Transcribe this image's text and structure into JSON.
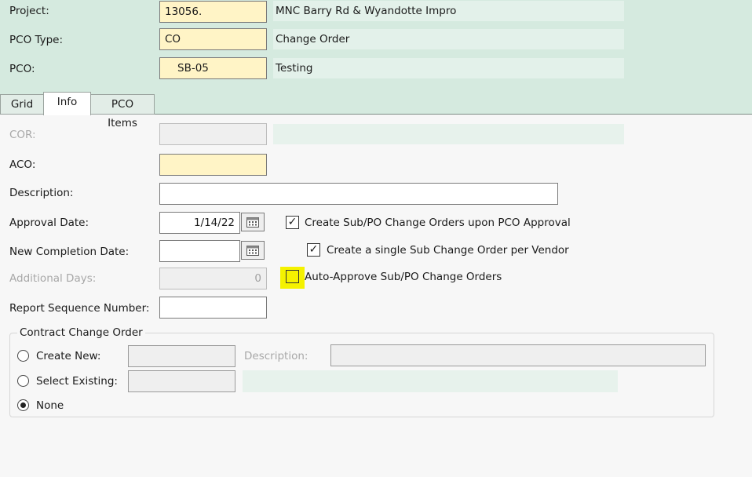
{
  "header": {
    "project": {
      "label": "Project:",
      "code": "13056.",
      "name": "MNC Barry Rd & Wyandotte Impro"
    },
    "pco_type": {
      "label": "PCO Type:",
      "code": "CO",
      "name": "Change Order"
    },
    "pco": {
      "label": "PCO:",
      "code": "SB-05",
      "name": "Testing"
    }
  },
  "tabs": [
    {
      "label": "Grid",
      "active": false
    },
    {
      "label": "Info",
      "active": true
    },
    {
      "label": "PCO Items",
      "active": false
    }
  ],
  "form": {
    "cor": {
      "label": "COR:",
      "value": ""
    },
    "aco": {
      "label": "ACO:",
      "value": ""
    },
    "description": {
      "label": "Description:",
      "value": ""
    },
    "approval_date": {
      "label": "Approval Date:",
      "value": "1/14/22"
    },
    "new_completion_date": {
      "label": "New Completion Date:",
      "value": ""
    },
    "additional_days": {
      "label": "Additional Days:",
      "value": "0"
    },
    "report_sequence": {
      "label": "Report Sequence Number:",
      "value": ""
    },
    "checkboxes": {
      "create_sub_po": {
        "label": "Create Sub/PO Change Orders upon PCO Approval",
        "checked": true
      },
      "single_per_vendor": {
        "label": "Create a single Sub Change Order per Vendor",
        "checked": true
      },
      "auto_approve": {
        "label": "Auto-Approve Sub/PO Change Orders",
        "checked": false,
        "highlight_color": "#f5f200"
      }
    }
  },
  "contract_change_order": {
    "legend": "Contract Change Order",
    "create_new": {
      "label": "Create New:",
      "selected": false,
      "value": ""
    },
    "description": {
      "label": "Description:",
      "value": ""
    },
    "select_existing": {
      "label": "Select Existing:",
      "selected": false,
      "value": ""
    },
    "none": {
      "label": "None",
      "selected": true
    }
  },
  "colors": {
    "header_bg": "#d5eadf",
    "required_field": "#fff4c6",
    "highlight": "#f5f200"
  },
  "icons": [
    "calendar-icon",
    "checkmark-icon",
    "radio-dot-icon"
  ]
}
